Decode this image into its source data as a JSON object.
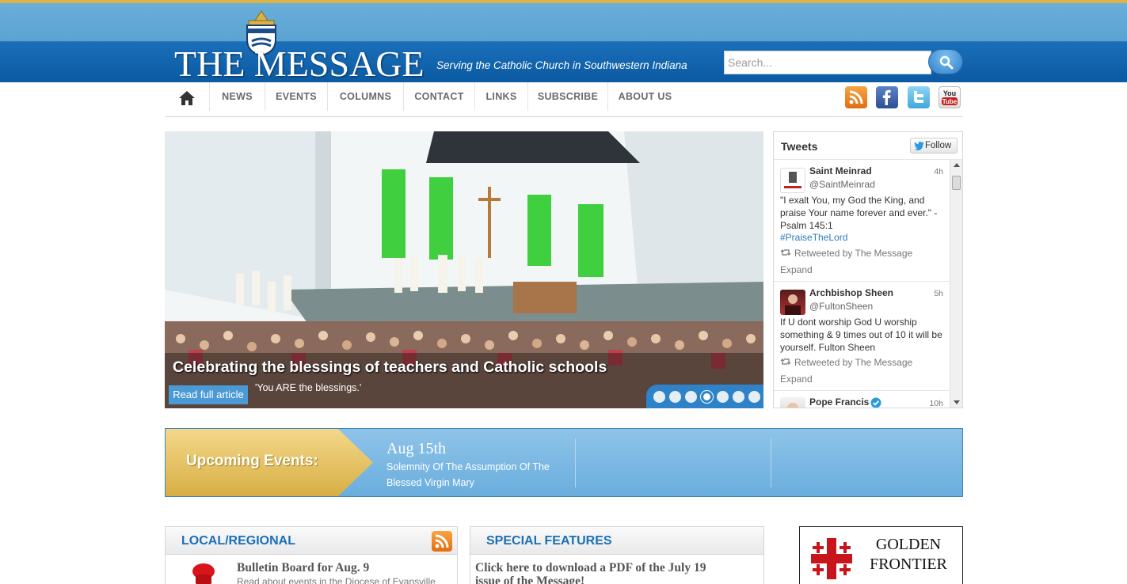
{
  "header": {
    "logo_text": "THE MESSAGE",
    "tagline": "Serving the Catholic Church in Southwestern Indiana",
    "search_placeholder": "Search..."
  },
  "nav": {
    "items": [
      "NEWS",
      "EVENTS",
      "COLUMNS",
      "CONTACT",
      "LINKS",
      "SUBSCRIBE",
      "ABOUT US"
    ],
    "social": [
      "rss-icon",
      "facebook-icon",
      "twitter-icon",
      "youtube-icon"
    ]
  },
  "hero": {
    "title": "Celebrating the blessings of teachers and Catholic schools",
    "read_more": "Read full article",
    "subtitle": "'You ARE the blessings.'",
    "slide_count": 7,
    "active_slide": 4
  },
  "tweets": {
    "title": "Tweets",
    "follow": "Follow",
    "items": [
      {
        "name": "Saint Meinrad",
        "handle": "@SaintMeinrad",
        "time": "4h",
        "text": "\"I exalt You, my God the King, and praise Your name forever and ever.\" - Psalm 145:1",
        "hashtag": "#PraiseTheLord",
        "retweet": "Retweeted by The Message",
        "expand": "Expand"
      },
      {
        "name": "Archbishop Sheen",
        "handle": "@FultonSheen",
        "time": "5h",
        "text": "If U dont worship God U worship something & 9 times out of 10 it will be yourself. Fulton Sheen",
        "retweet": "Retweeted by The Message",
        "expand": "Expand"
      },
      {
        "name": "Pope Francis",
        "time": "10h"
      }
    ]
  },
  "events": {
    "label": "Upcoming Events:",
    "items": [
      {
        "date": "Aug 15th",
        "title": "Solemnity Of The Assumption Of The Blessed Virgin Mary"
      }
    ]
  },
  "sections": {
    "local": {
      "title": "LOCAL/REGIONAL",
      "article_title": "Bulletin Board for Aug. 9",
      "article_sub": "Read about events in the Diocese of Evansville"
    },
    "features": {
      "title": "SPECIAL FEATURES",
      "article_title": "Click here to download a PDF of the July 19",
      "article_title2": "issue of the Message!"
    }
  },
  "ad": {
    "line1": "GOLDEN",
    "line2": "FRONTIER"
  }
}
